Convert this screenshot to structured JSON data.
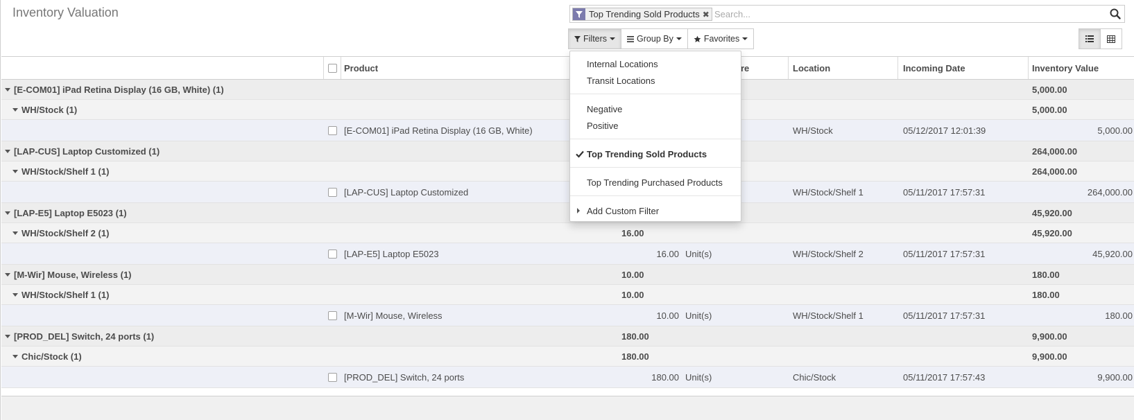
{
  "page": {
    "title": "Inventory Valuation"
  },
  "search": {
    "facet": "Top Trending Sold Products",
    "placeholder": "Search..."
  },
  "buttons": {
    "filters": "Filters",
    "group_by": "Group By",
    "favorites": "Favorites"
  },
  "columns": {
    "product": "Product",
    "uom_partial": "ure",
    "location": "Location",
    "incoming_date": "Incoming Date",
    "inventory_value": "Inventory Value"
  },
  "rows": [
    {
      "type": "g1",
      "label": "[E-COM01] iPad Retina Display (16 GB, White) (1)",
      "qty": "",
      "value": "5,000.00"
    },
    {
      "type": "g2",
      "label": "WH/Stock (1)",
      "qty": "",
      "value": "5,000.00"
    },
    {
      "type": "rec",
      "product": "[E-COM01] iPad Retina Display (16 GB, White)",
      "qty": "",
      "uom": "",
      "location": "WH/Stock",
      "date": "05/12/2017 12:01:39",
      "value": "5,000.00"
    },
    {
      "type": "g1",
      "label": "[LAP-CUS] Laptop Customized (1)",
      "qty": "",
      "value": "264,000.00"
    },
    {
      "type": "g2",
      "label": "WH/Stock/Shelf 1 (1)",
      "qty": "",
      "value": "264,000.00"
    },
    {
      "type": "rec",
      "product": "[LAP-CUS] Laptop Customized",
      "qty": "",
      "uom": "",
      "location": "WH/Stock/Shelf 1",
      "date": "05/11/2017 17:57:31",
      "value": "264,000.00"
    },
    {
      "type": "g1",
      "label": "[LAP-E5] Laptop E5023 (1)",
      "qty": "",
      "value": "45,920.00"
    },
    {
      "type": "g2",
      "label": "WH/Stock/Shelf 2 (1)",
      "qty": "16.00",
      "value": "45,920.00"
    },
    {
      "type": "rec",
      "product": "[LAP-E5] Laptop E5023",
      "qty": "16.00",
      "uom": "Unit(s)",
      "location": "WH/Stock/Shelf 2",
      "date": "05/11/2017 17:57:31",
      "value": "45,920.00"
    },
    {
      "type": "g1",
      "label": "[M-Wir] Mouse, Wireless (1)",
      "qty": "10.00",
      "value": "180.00"
    },
    {
      "type": "g2",
      "label": "WH/Stock/Shelf 1 (1)",
      "qty": "10.00",
      "value": "180.00"
    },
    {
      "type": "rec",
      "product": "[M-Wir] Mouse, Wireless",
      "qty": "10.00",
      "uom": "Unit(s)",
      "location": "WH/Stock/Shelf 1",
      "date": "05/11/2017 17:57:31",
      "value": "180.00"
    },
    {
      "type": "g1",
      "label": "[PROD_DEL] Switch, 24 ports (1)",
      "qty": "180.00",
      "value": "9,900.00"
    },
    {
      "type": "g2",
      "label": "Chic/Stock (1)",
      "qty": "180.00",
      "value": "9,900.00"
    },
    {
      "type": "rec",
      "product": "[PROD_DEL] Switch, 24 ports",
      "qty": "180.00",
      "uom": "Unit(s)",
      "location": "Chic/Stock",
      "date": "05/11/2017 17:57:43",
      "value": "9,900.00"
    }
  ],
  "filters_menu": {
    "internal_locations": "Internal Locations",
    "transit_locations": "Transit Locations",
    "negative": "Negative",
    "positive": "Positive",
    "top_sold": "Top Trending Sold Products",
    "top_purchased": "Top Trending Purchased Products",
    "add_custom": "Add Custom Filter"
  },
  "colors": {
    "facet_icon_bg": "#7c7bad",
    "record_row_bg": "#eef0f7",
    "group_row_bg": "#ededed"
  }
}
